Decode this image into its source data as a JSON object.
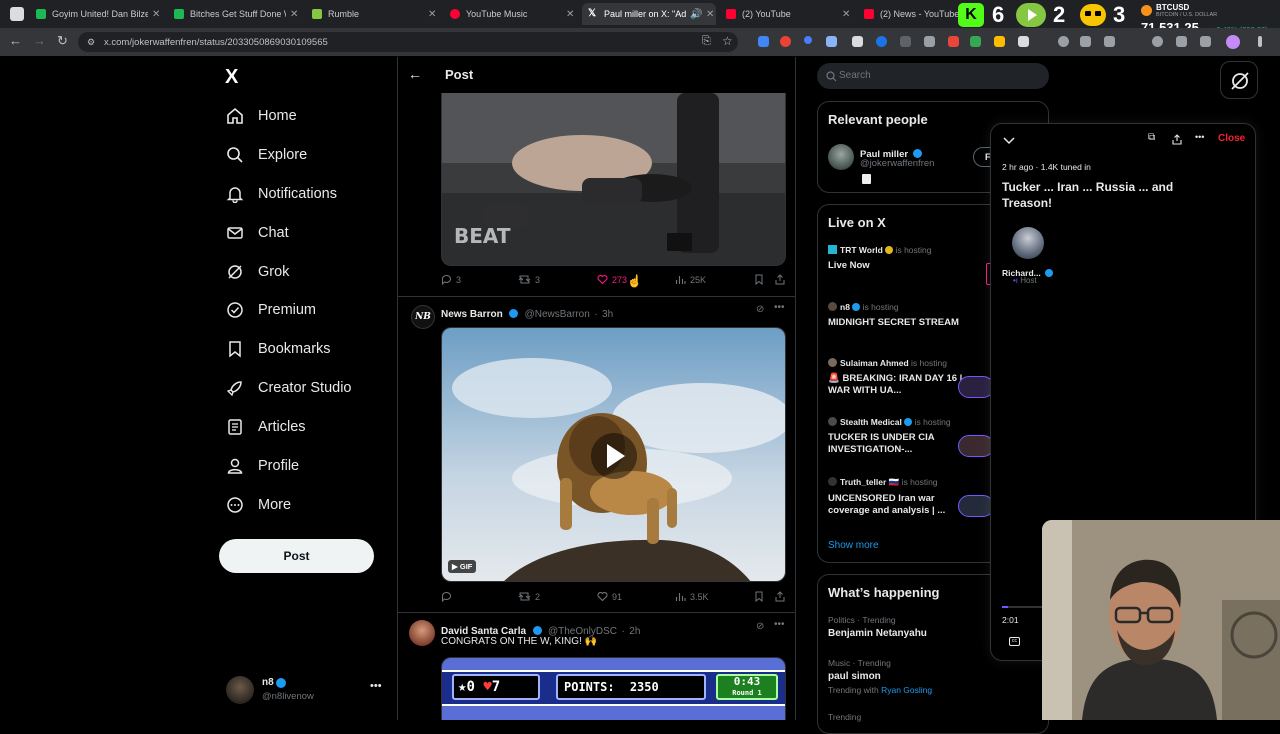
{
  "browser": {
    "tabs": [
      {
        "title": "Goyim United! Dan Bilzerian",
        "color": "#1db954"
      },
      {
        "title": "Bitches Get Stuff Done W",
        "color": "#1db954"
      },
      {
        "title": "Rumble",
        "color": "#85c742"
      },
      {
        "title": "YouTube Music",
        "color": "#ff0033"
      },
      {
        "title": "Paul miller on X: \"Adi",
        "color": "#ffffff"
      },
      {
        "title": "(2) YouTube",
        "color": "#ff0033"
      },
      {
        "title": "(2) News - YouTube",
        "color": "#ff0033"
      }
    ],
    "url": "x.com/jokerwaffenfren/status/2033050869030109565",
    "overlay_counts": [
      "6",
      "2",
      "3"
    ],
    "ticker": {
      "symbol": "BTCUSD",
      "sub": "BITCOIN / U.S. DOLLAR",
      "price": "71,531.25",
      "change": "+0.42% (299.23)"
    }
  },
  "sidebar": {
    "logo": "X",
    "items": [
      {
        "label": "Home",
        "icon": "home-icon"
      },
      {
        "label": "Explore",
        "icon": "search-icon"
      },
      {
        "label": "Notifications",
        "icon": "bell-icon"
      },
      {
        "label": "Chat",
        "icon": "mail-icon"
      },
      {
        "label": "Grok",
        "icon": "grok-icon"
      },
      {
        "label": "Premium",
        "icon": "premium-icon"
      },
      {
        "label": "Bookmarks",
        "icon": "bookmark-icon"
      },
      {
        "label": "Creator Studio",
        "icon": "rocket-icon"
      },
      {
        "label": "Articles",
        "icon": "article-icon"
      },
      {
        "label": "Profile",
        "icon": "person-icon"
      },
      {
        "label": "More",
        "icon": "more-circle-icon"
      }
    ],
    "post_label": "Post",
    "account": {
      "name": "n8",
      "handle": "@n8livenow"
    }
  },
  "header": {
    "title": "Post"
  },
  "tweets": [
    {
      "actions": {
        "replies": "3",
        "reposts": "3",
        "likes": "273",
        "views": "25K"
      }
    },
    {
      "name": "News Barron",
      "handle": "@NewsBarron",
      "time": "3h",
      "avatar_text": "NB",
      "badge": "GIF",
      "actions": {
        "replies": "",
        "reposts": "2",
        "likes": "91",
        "views": "3.5K"
      }
    },
    {
      "name": "David Santa Carla",
      "handle": "@TheOnlyDSC",
      "time": "2h",
      "text": "CONGRATS ON THE W, KING! 🙌",
      "game": {
        "stars": "0",
        "hearts": "7",
        "points_label": "POINTS:",
        "points": "2350",
        "timer": "0:43",
        "round": "Round 1"
      }
    }
  ],
  "right": {
    "search_placeholder": "Search",
    "relevant": {
      "title": "Relevant people",
      "name": "Paul miller",
      "handle": "@jokerwaffenfren",
      "follow": "F"
    },
    "live": {
      "title": "Live on X",
      "items": [
        {
          "host": "TRT World",
          "status": "is hosting",
          "title": "Live Now"
        },
        {
          "host": "n8",
          "status": "is hosting",
          "title": "MIDNIGHT SECRET STREAM"
        },
        {
          "host": "Sulaiman Ahmed",
          "status": "is hosting",
          "title": "🚨 BREAKING: IRAN DAY 16 | WAR WITH UA..."
        },
        {
          "host": "Stealth Medical",
          "status": "is hosting",
          "title": "TUCKER IS UNDER CIA INVESTIGATION-..."
        },
        {
          "host": "Truth_teller 🇷🇺",
          "status": "is hosting",
          "title": "UNCENSORED Iran war coverage and analysis | ..."
        }
      ],
      "show_more": "Show more"
    },
    "happening": {
      "title": "What’s happening",
      "items": [
        {
          "context": "Politics · Trending",
          "topic": "Benjamin Netanyahu",
          "extra": ""
        },
        {
          "context": "Music · Trending",
          "topic": "paul simon",
          "extra_prefix": "Trending with",
          "extra": "Ryan Gosling"
        },
        {
          "context": "Trending",
          "topic": "",
          "extra": ""
        }
      ]
    }
  },
  "space": {
    "close": "Close",
    "meta": "2 hr ago · 1.4K tuned in",
    "title": "Tucker ... Iran ... Russia ... and Treason!",
    "host_name": "Richard...",
    "host_role": "Host",
    "time": "2:01",
    "progress": 0.15
  }
}
